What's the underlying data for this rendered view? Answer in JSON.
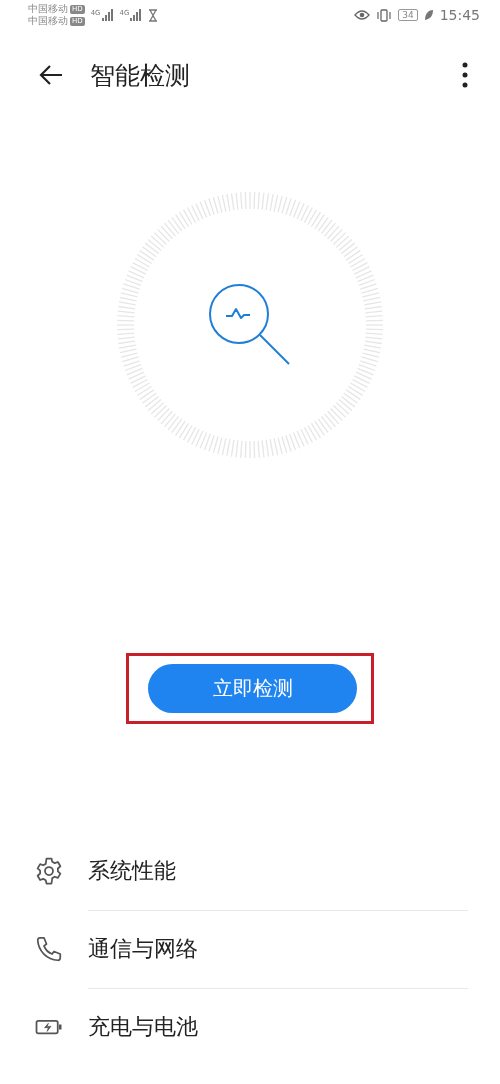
{
  "status_bar": {
    "carriers": [
      {
        "name": "中国移动",
        "badge": "HD"
      },
      {
        "name": "中国移动",
        "badge": "HD"
      }
    ],
    "signals": [
      {
        "network": "4G"
      },
      {
        "network": "4G"
      }
    ],
    "battery": "34",
    "time": "15:45"
  },
  "header": {
    "title": "智能检测"
  },
  "scan": {
    "button": "立即检测",
    "highlighted": true
  },
  "items": [
    {
      "kind": "gear",
      "label": "系统性能"
    },
    {
      "kind": "phone",
      "label": "通信与网络"
    },
    {
      "kind": "battery",
      "label": "充电与电池"
    }
  ]
}
